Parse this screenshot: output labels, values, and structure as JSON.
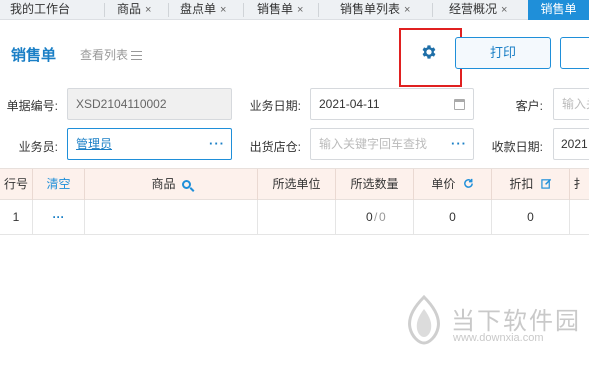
{
  "tabs": [
    {
      "label": "我的工作台",
      "closable": false
    },
    {
      "label": "商品",
      "closable": true
    },
    {
      "label": "盘点单",
      "closable": true
    },
    {
      "label": "销售单",
      "closable": true
    },
    {
      "label": "销售单列表",
      "closable": true
    },
    {
      "label": "经营概况",
      "closable": true
    },
    {
      "label": "销售单",
      "closable": false,
      "active": true
    }
  ],
  "tab_close_glyph": "×",
  "header": {
    "title": "销售单",
    "view_list_label": "查看列表",
    "print_label": "打印"
  },
  "form": {
    "order_no_label": "单据编号:",
    "order_no_value": "XSD2104110002",
    "biz_date_label": "业务日期:",
    "biz_date_value": "2021-04-11",
    "customer_label": "客户:",
    "customer_placeholder": "输入关",
    "salesman_label": "业务员:",
    "salesman_value": "管理员",
    "store_label": "出货店仓:",
    "store_placeholder": "输入关键字回车查找",
    "collect_date_label": "收款日期:",
    "collect_date_value": "2021",
    "more_glyph": "···"
  },
  "table": {
    "headers": {
      "row_no": "行号",
      "clear": "清空",
      "product": "商品",
      "unit": "所选单位",
      "qty": "所选数量",
      "price": "单价",
      "discount": "折扣",
      "extra": "扌"
    },
    "rows": [
      {
        "row_no": "1",
        "action": "···",
        "product": "",
        "unit": "",
        "qty_a": "0",
        "qty_sep": "/",
        "qty_b": "0",
        "price": "0",
        "discount": "0"
      }
    ]
  },
  "watermark": {
    "name": "当下软件园",
    "url": "www.downxia.com"
  },
  "colors": {
    "accent": "#1f8fd9",
    "active_tab": "#1f8fd9",
    "header_row_bg": "#fdf1ec",
    "highlight_box": "#e02020"
  }
}
